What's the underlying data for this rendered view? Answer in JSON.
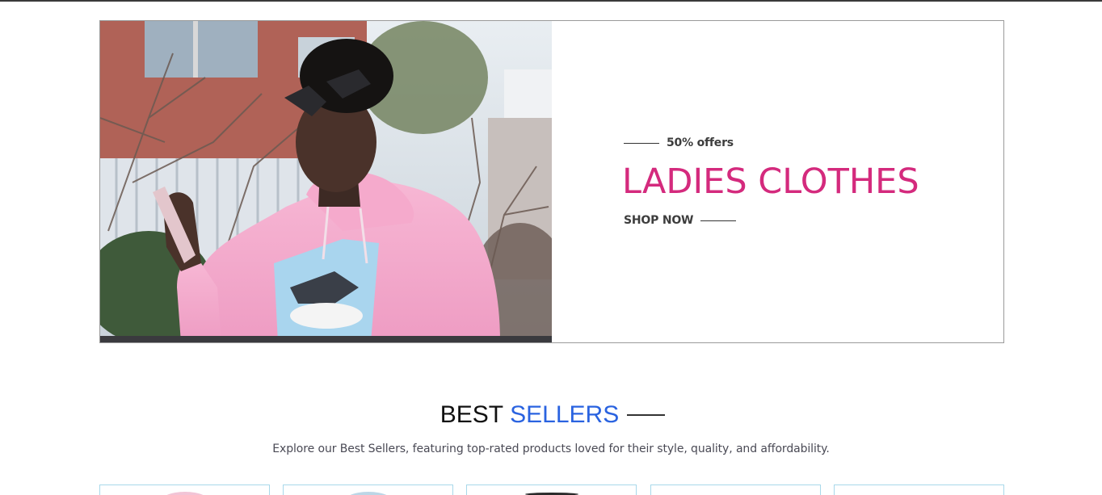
{
  "hero": {
    "offer_text": "50% offers",
    "title": "LADIES CLOTHES",
    "cta_label": "SHOP NOW",
    "title_color": "#d42a7d"
  },
  "best_sellers": {
    "heading_part1": "BEST",
    "heading_part2": "SELLERS",
    "heading_accent": "#2a63e0",
    "description": "Explore our Best Sellers, featuring top-rated products loved for their style, quality, and affordability."
  },
  "product_cards": [
    {
      "peek_color": "#f2c4d6"
    },
    {
      "peek_color": "#bcd6e6"
    },
    {
      "peek_color": "#2b2b2b"
    },
    {
      "peek_color": "#ffffff"
    },
    {
      "peek_color": "#ffffff"
    }
  ]
}
